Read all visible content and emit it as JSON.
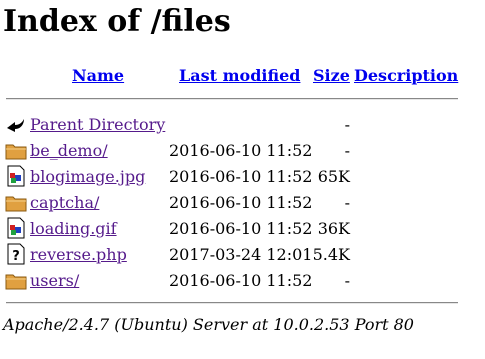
{
  "page": {
    "title": "Index of /files",
    "columns": {
      "name": "Name",
      "last_modified": "Last modified",
      "size": "Size",
      "description": "Description"
    },
    "parent": {
      "label": "Parent Directory",
      "size": "-",
      "icon": "back-arrow-icon"
    },
    "rows": [
      {
        "name": "be_demo/",
        "modified": "2016-06-10 11:52",
        "size": "-",
        "icon": "folder-icon"
      },
      {
        "name": "blogimage.jpg",
        "modified": "2016-06-10 11:52",
        "size": "65K",
        "icon": "image-file-icon"
      },
      {
        "name": "captcha/",
        "modified": "2016-06-10 11:52",
        "size": "-",
        "icon": "folder-icon"
      },
      {
        "name": "loading.gif",
        "modified": "2016-06-10 11:52",
        "size": "36K",
        "icon": "image-file-icon"
      },
      {
        "name": "reverse.php",
        "modified": "2017-03-24 12:01",
        "size": "5.4K",
        "icon": "unknown-file-icon"
      },
      {
        "name": "users/",
        "modified": "2016-06-10 11:52",
        "size": "-",
        "icon": "folder-icon"
      }
    ],
    "signature": "Apache/2.4.7 (Ubuntu) Server at 10.0.2.53 Port 80"
  },
  "colors": {
    "link": "#0000ee",
    "visited_link": "#551a8b",
    "folder": "#e0a040"
  }
}
